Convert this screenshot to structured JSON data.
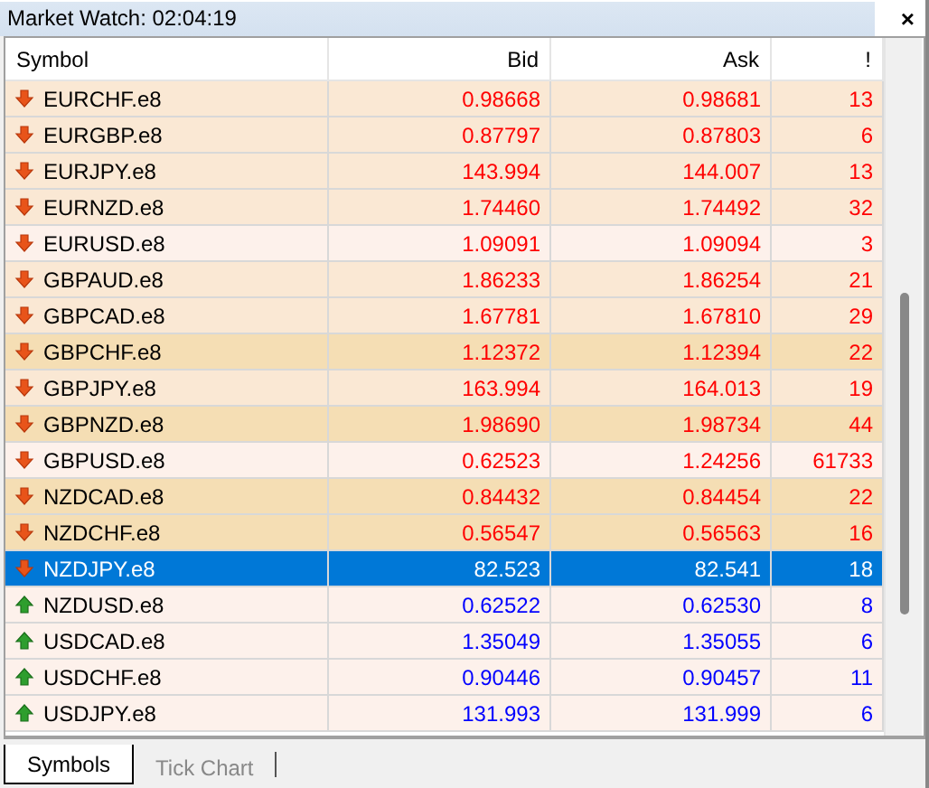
{
  "window": {
    "title": "Market Watch: 02:04:19",
    "close": "×"
  },
  "table": {
    "columns": [
      "Symbol",
      "Bid",
      "Ask",
      "!"
    ],
    "rows": [
      {
        "symbol": "EURCHF.e8",
        "bid": "0.98668",
        "ask": "0.98681",
        "spread": "13",
        "kind": "down",
        "color": "#fae8d4",
        "selected": false
      },
      {
        "symbol": "EURGBP.e8",
        "bid": "0.87797",
        "ask": "0.87803",
        "spread": "6",
        "kind": "down",
        "color": "#fae8d4",
        "selected": false
      },
      {
        "symbol": "EURJPY.e8",
        "bid": "143.994",
        "ask": "144.007",
        "spread": "13",
        "kind": "down",
        "color": "#fae8d4",
        "selected": false
      },
      {
        "symbol": "EURNZD.e8",
        "bid": "1.74460",
        "ask": "1.74492",
        "spread": "32",
        "kind": "down",
        "color": "#fae8d4",
        "selected": false
      },
      {
        "symbol": "EURUSD.e8",
        "bid": "1.09091",
        "ask": "1.09094",
        "spread": "3",
        "kind": "down",
        "color": "#fdf1eb",
        "selected": false
      },
      {
        "symbol": "GBPAUD.e8",
        "bid": "1.86233",
        "ask": "1.86254",
        "spread": "21",
        "kind": "down",
        "color": "#fae8d4",
        "selected": false
      },
      {
        "symbol": "GBPCAD.e8",
        "bid": "1.67781",
        "ask": "1.67810",
        "spread": "29",
        "kind": "down",
        "color": "#fae8d4",
        "selected": false
      },
      {
        "symbol": "GBPCHF.e8",
        "bid": "1.12372",
        "ask": "1.12394",
        "spread": "22",
        "kind": "down",
        "color": "#f5deb4",
        "selected": false
      },
      {
        "symbol": "GBPJPY.e8",
        "bid": "163.994",
        "ask": "164.013",
        "spread": "19",
        "kind": "down",
        "color": "#fae8d4",
        "selected": false
      },
      {
        "symbol": "GBPNZD.e8",
        "bid": "1.98690",
        "ask": "1.98734",
        "spread": "44",
        "kind": "down",
        "color": "#f5deb4",
        "selected": false
      },
      {
        "symbol": "GBPUSD.e8",
        "bid": "0.62523",
        "ask": "1.24256",
        "spread": "61733",
        "kind": "down",
        "color": "#fdf1eb",
        "selected": false
      },
      {
        "symbol": "NZDCAD.e8",
        "bid": "0.84432",
        "ask": "0.84454",
        "spread": "22",
        "kind": "down",
        "color": "#f5deb4",
        "selected": false
      },
      {
        "symbol": "NZDCHF.e8",
        "bid": "0.56547",
        "ask": "0.56563",
        "spread": "16",
        "kind": "down",
        "color": "#f5deb4",
        "selected": false
      },
      {
        "symbol": "NZDJPY.e8",
        "bid": "82.523",
        "ask": "82.541",
        "spread": "18",
        "kind": "down",
        "selected": true
      },
      {
        "symbol": "NZDUSD.e8",
        "bid": "0.62522",
        "ask": "0.62530",
        "spread": "8",
        "kind": "up",
        "color": "#fdf1eb",
        "selected": false
      },
      {
        "symbol": "USDCAD.e8",
        "bid": "1.35049",
        "ask": "1.35055",
        "spread": "6",
        "kind": "up",
        "color": "#fdf1eb",
        "selected": false
      },
      {
        "symbol": "USDCHF.e8",
        "bid": "0.90446",
        "ask": "0.90457",
        "spread": "11",
        "kind": "up",
        "color": "#fdf1eb",
        "selected": false
      },
      {
        "symbol": "USDJPY.e8",
        "bid": "131.993",
        "ask": "131.999",
        "spread": "6",
        "kind": "up",
        "color": "#fdf1eb",
        "selected": false
      }
    ]
  },
  "tabs": [
    {
      "label": "Symbols",
      "selected": true
    },
    {
      "label": "Tick Chart",
      "selected": false
    }
  ]
}
